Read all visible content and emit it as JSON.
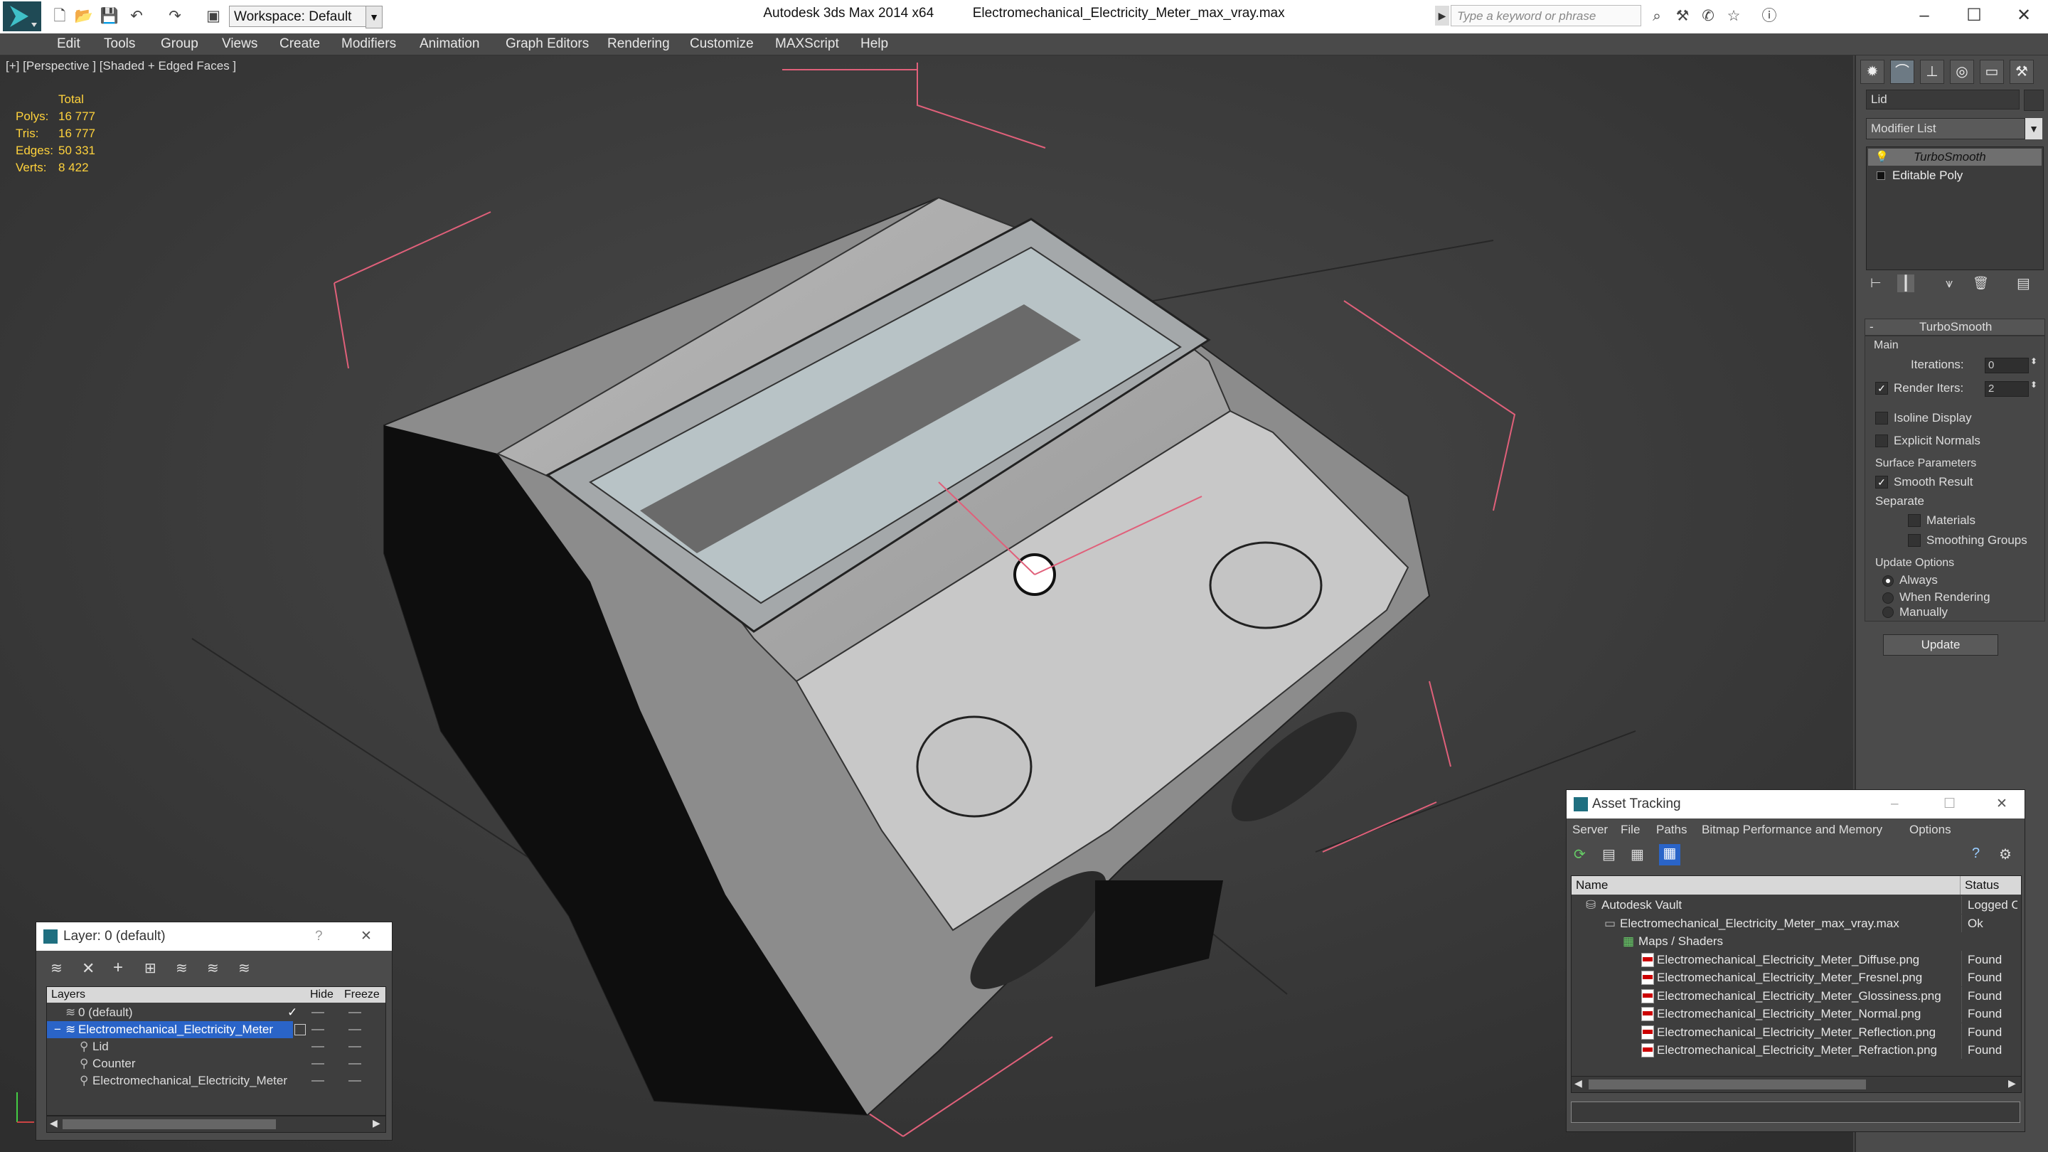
{
  "app": {
    "title": "Autodesk 3ds Max 2014 x64",
    "filename": "Electromechanical_Electricity_Meter_max_vray.max"
  },
  "toolbar": {
    "workspace": "Workspace: Default",
    "search_placeholder": "Type a keyword or phrase"
  },
  "menu": [
    "Edit",
    "Tools",
    "Group",
    "Views",
    "Create",
    "Modifiers",
    "Animation",
    "Graph Editors",
    "Rendering",
    "Customize",
    "MAXScript",
    "Help"
  ],
  "viewport": {
    "label": "[+] [Perspective ] [Shaded + Edged Faces ]",
    "stats": {
      "header": "Total",
      "rows": [
        {
          "label": "Polys:",
          "value": "16 777"
        },
        {
          "label": "Tris:",
          "value": "16 777"
        },
        {
          "label": "Edges:",
          "value": "50 331"
        },
        {
          "label": "Verts:",
          "value": "8 422"
        }
      ]
    }
  },
  "command_panel": {
    "object_name": "Lid",
    "modifier_list": "Modifier List",
    "stack": [
      "TurboSmooth",
      "Editable Poly"
    ],
    "turbosmooth": {
      "title": "TurboSmooth",
      "main": "Main",
      "iterations_label": "Iterations:",
      "iterations": "0",
      "render_iters_label": "Render Iters:",
      "render_iters": "2",
      "isoline": "Isoline Display",
      "explicit_normals": "Explicit Normals",
      "surface_params": "Surface Parameters",
      "smooth_result": "Smooth Result",
      "separate": "Separate",
      "materials": "Materials",
      "smoothing_groups": "Smoothing Groups",
      "update_options": "Update Options",
      "always": "Always",
      "when_rendering": "When Rendering",
      "manually": "Manually",
      "update_button": "Update"
    }
  },
  "layer_dialog": {
    "title": "Layer: 0 (default)",
    "help": "?",
    "close": "✕",
    "columns": [
      "Layers",
      "Hide",
      "Freeze"
    ],
    "rows": [
      {
        "name": "0 (default)",
        "indent": 1,
        "selected": false
      },
      {
        "name": "Electromechanical_Electricity_Meter",
        "indent": 1,
        "selected": true
      },
      {
        "name": "Lid",
        "indent": 2,
        "selected": false
      },
      {
        "name": "Counter",
        "indent": 2,
        "selected": false
      },
      {
        "name": "Electromechanical_Electricity_Meter",
        "indent": 2,
        "selected": false
      }
    ]
  },
  "asset_tracking": {
    "title": "Asset Tracking",
    "menu": [
      "Server",
      "File",
      "Paths",
      "Bitmap Performance and Memory",
      "Options"
    ],
    "columns": [
      "Name",
      "Status"
    ],
    "rows": [
      {
        "name": "Autodesk Vault",
        "status": "Logged O",
        "indent": 1,
        "icon": "vault"
      },
      {
        "name": "Electromechanical_Electricity_Meter_max_vray.max",
        "status": "Ok",
        "indent": 2,
        "icon": "max"
      },
      {
        "name": "Maps / Shaders",
        "status": "",
        "indent": 3,
        "icon": "maps"
      },
      {
        "name": "Electromechanical_Electricity_Meter_Diffuse.png",
        "status": "Found",
        "indent": 4,
        "icon": "png"
      },
      {
        "name": "Electromechanical_Electricity_Meter_Fresnel.png",
        "status": "Found",
        "indent": 4,
        "icon": "png"
      },
      {
        "name": "Electromechanical_Electricity_Meter_Glossiness.png",
        "status": "Found",
        "indent": 4,
        "icon": "png"
      },
      {
        "name": "Electromechanical_Electricity_Meter_Normal.png",
        "status": "Found",
        "indent": 4,
        "icon": "png"
      },
      {
        "name": "Electromechanical_Electricity_Meter_Reflection.png",
        "status": "Found",
        "indent": 4,
        "icon": "png"
      },
      {
        "name": "Electromechanical_Electricity_Meter_Refraction.png",
        "status": "Found",
        "indent": 4,
        "icon": "png"
      }
    ]
  }
}
